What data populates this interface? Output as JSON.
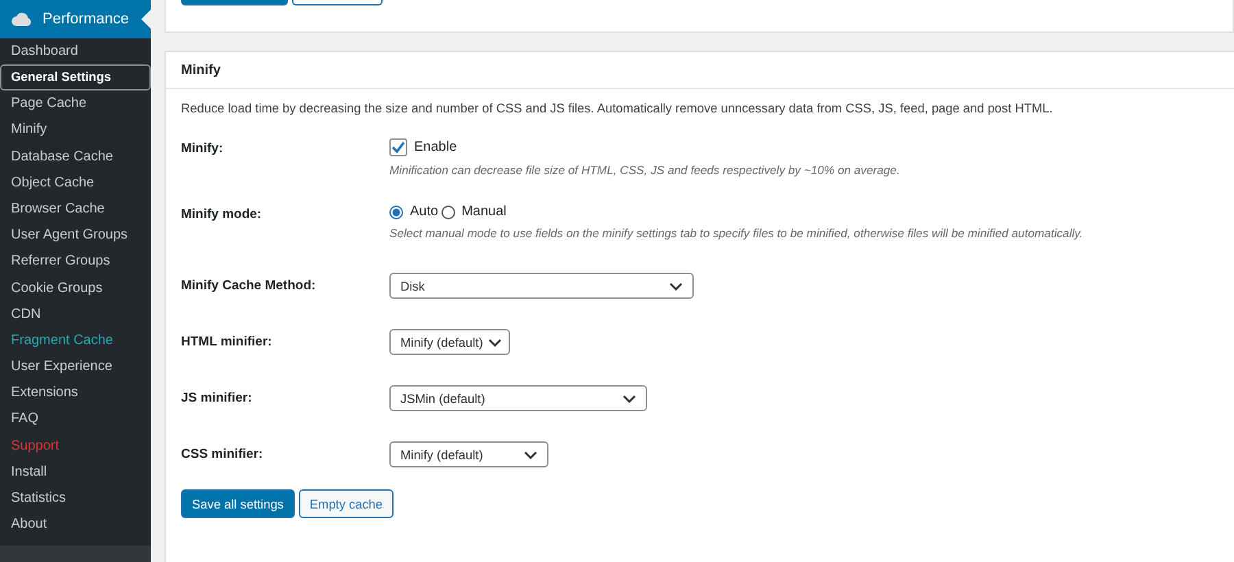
{
  "sidebar": {
    "title": "Performance",
    "items": [
      {
        "label": "Dashboard",
        "selected": false,
        "kind": "normal"
      },
      {
        "label": "General Settings",
        "selected": true,
        "kind": "normal"
      },
      {
        "label": "Page Cache",
        "selected": false,
        "kind": "normal"
      },
      {
        "label": "Minify",
        "selected": false,
        "kind": "normal"
      },
      {
        "label": "Database Cache",
        "selected": false,
        "kind": "normal"
      },
      {
        "label": "Object Cache",
        "selected": false,
        "kind": "normal"
      },
      {
        "label": "Browser Cache",
        "selected": false,
        "kind": "normal"
      },
      {
        "label": "User Agent Groups",
        "selected": false,
        "kind": "normal"
      },
      {
        "label": "Referrer Groups",
        "selected": false,
        "kind": "normal"
      },
      {
        "label": "Cookie Groups",
        "selected": false,
        "kind": "normal"
      },
      {
        "label": "CDN",
        "selected": false,
        "kind": "normal"
      },
      {
        "label": "Fragment Cache",
        "selected": false,
        "kind": "highlight"
      },
      {
        "label": "User Experience",
        "selected": false,
        "kind": "normal"
      },
      {
        "label": "Extensions",
        "selected": false,
        "kind": "normal"
      },
      {
        "label": "FAQ",
        "selected": false,
        "kind": "normal"
      },
      {
        "label": "Support",
        "selected": false,
        "kind": "alert"
      },
      {
        "label": "Install",
        "selected": false,
        "kind": "normal"
      },
      {
        "label": "Statistics",
        "selected": false,
        "kind": "normal"
      },
      {
        "label": "About",
        "selected": false,
        "kind": "normal"
      }
    ]
  },
  "section": {
    "title": "Minify",
    "description": "Reduce load time by decreasing the size and number of CSS and JS files. Automatically remove unncessary data from CSS, JS, feed, page and post HTML.",
    "rows": [
      {
        "kind": "checkbox",
        "label": "Minify:",
        "option": "Enable",
        "checked": true,
        "hint": "Minification can decrease file size of HTML, CSS, JS and feeds respectively by ~10% on average."
      },
      {
        "kind": "radio",
        "label": "Minify mode:",
        "options": [
          {
            "label": "Auto",
            "selected": true
          },
          {
            "label": "Manual",
            "selected": false
          }
        ],
        "hint": "Select manual mode to use fields on the minify settings tab to specify files to be minified, otherwise files will be minified automatically."
      },
      {
        "kind": "select",
        "label": "Minify Cache Method:",
        "value": "Disk"
      },
      {
        "kind": "select",
        "label": "HTML minifier:",
        "value": "Minify (default)"
      },
      {
        "kind": "select",
        "label": "JS minifier:",
        "value": "JSMin (default)"
      },
      {
        "kind": "select",
        "label": "CSS minifier:",
        "value": "Minify (default)"
      }
    ],
    "buttons": [
      {
        "label": "Save all settings",
        "kind": "primary"
      },
      {
        "label": "Empty cache",
        "kind": "secondary"
      }
    ]
  }
}
